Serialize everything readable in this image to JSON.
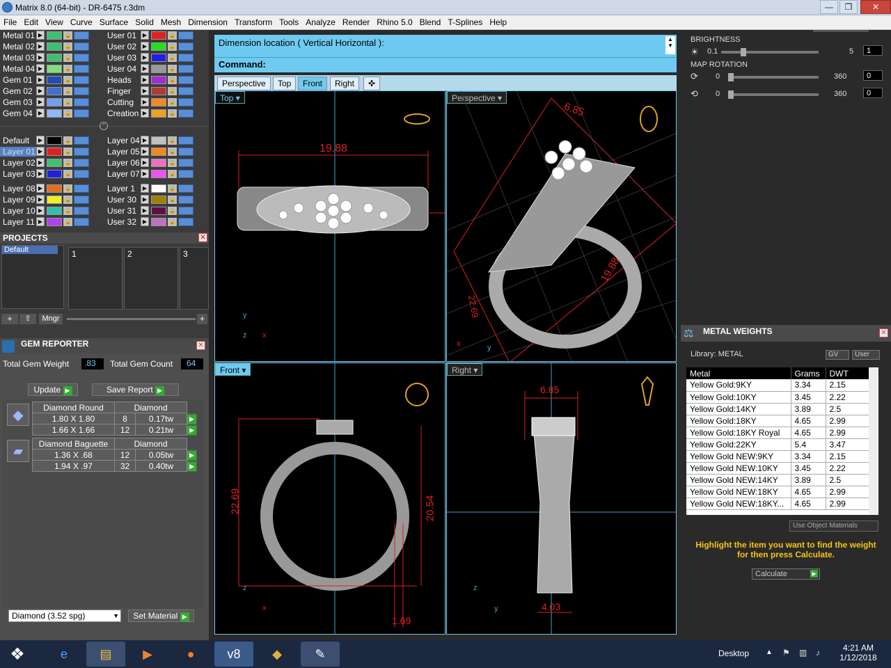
{
  "window": {
    "title": "Matrix 8.0 (64-bit) - DR-6475 r.3dm"
  },
  "menu": [
    "File",
    "Edit",
    "View",
    "Curve",
    "Surface",
    "Solid",
    "Mesh",
    "Dimension",
    "Transform",
    "Tools",
    "Analyze",
    "Render",
    "Rhino 5.0",
    "Blend",
    "T-Splines",
    "Help"
  ],
  "layers": {
    "metal_left": [
      {
        "name": "Metal 01",
        "color": "#3fbf6f"
      },
      {
        "name": "Metal 02",
        "color": "#3fbf6f"
      },
      {
        "name": "Metal 03",
        "color": "#3fbf6f"
      },
      {
        "name": "Metal 04",
        "color": "#7fdf7f"
      }
    ],
    "user_right": [
      {
        "name": "User 01",
        "color": "#e02020"
      },
      {
        "name": "User 02",
        "color": "#20e020"
      },
      {
        "name": "User 03",
        "color": "#2020e0"
      },
      {
        "name": "User 04",
        "color": "#9a9a9a"
      }
    ],
    "gem_left": [
      {
        "name": "Gem 01",
        "color": "#1f4fb0"
      },
      {
        "name": "Gem 02",
        "color": "#3f6fd0"
      },
      {
        "name": "Gem 03",
        "color": "#6f9ff0"
      },
      {
        "name": "Gem 04",
        "color": "#8fb8ff"
      }
    ],
    "misc_right": [
      {
        "name": "Heads",
        "color": "#9f2fd0"
      },
      {
        "name": "Finger",
        "color": "#b03a3a"
      },
      {
        "name": "Cutting",
        "color": "#f08a20"
      },
      {
        "name": "Creation",
        "color": "#f0a020"
      }
    ],
    "default_left": [
      {
        "name": "Default",
        "color": "#000000"
      },
      {
        "name": "Layer 01",
        "color": "#e02020"
      },
      {
        "name": "Layer 02",
        "color": "#3fbf6f"
      },
      {
        "name": "Layer 03",
        "color": "#2020e0"
      }
    ],
    "layer_right": [
      {
        "name": "Layer 04",
        "color": "#c0c0c0"
      },
      {
        "name": "Layer 05",
        "color": "#f08a20"
      },
      {
        "name": "Layer 06",
        "color": "#f070c0"
      },
      {
        "name": "Layer 07",
        "color": "#f050f0"
      }
    ],
    "bottom_left": [
      {
        "name": "Layer 08",
        "color": "#e07020"
      },
      {
        "name": "Layer 09",
        "color": "#f0f020"
      },
      {
        "name": "Layer 10",
        "color": "#30c0b0"
      },
      {
        "name": "Layer 11",
        "color": "#b040f0"
      }
    ],
    "bottom_right": [
      {
        "name": "Layer 1",
        "color": "#ffffff"
      },
      {
        "name": "User 30",
        "color": "#a08000"
      },
      {
        "name": "User 31",
        "color": "#601040"
      },
      {
        "name": "User 32",
        "color": "#c070c0"
      }
    ]
  },
  "projects": {
    "title": "PROJECTS",
    "list_item": "Default",
    "slots": [
      "1",
      "2",
      "3"
    ],
    "mngr_label": "Mngr"
  },
  "gem_reporter": {
    "title": "GEM REPORTER",
    "total_weight_label": "Total Gem Weight",
    "total_weight_value": ".83",
    "total_count_label": "Total Gem Count",
    "total_count_value": "64",
    "update_label": "Update",
    "save_label": "Save Report",
    "groups": [
      {
        "name": "Diamond Round",
        "material": "Diamond",
        "rows": [
          {
            "size": "1.80 X 1.80",
            "count": "8",
            "tw": "0.17tw"
          },
          {
            "size": "1.66 X 1.66",
            "count": "12",
            "tw": "0.21tw"
          }
        ]
      },
      {
        "name": "Diamond Baguette",
        "material": "Diamond",
        "rows": [
          {
            "size": "1.36 X .68",
            "count": "12",
            "tw": "0.05tw"
          },
          {
            "size": "1.94 X .97",
            "count": "32",
            "tw": "0.40tw"
          }
        ]
      }
    ],
    "material_select": "Diamond    (3.52 spg)",
    "set_material_label": "Set Material"
  },
  "command": {
    "prompt": "Dimension location ( Vertical  Horizontal ):",
    "label": "Command:"
  },
  "view_tabs": [
    "Perspective",
    "Top",
    "Front",
    "Right"
  ],
  "viewports": {
    "top": {
      "label": "Top",
      "dim": "19.88"
    },
    "perspective": {
      "label": "Perspective",
      "dim1": "6.85",
      "dim2": "19.88",
      "dim3": "22.69"
    },
    "front": {
      "label": "Front",
      "dim_h": "22.69",
      "dim_h2": "20.54",
      "dim_w": "1.69"
    },
    "right": {
      "label": "Right",
      "dim_top": "6.85",
      "dim_bottom": "4.03"
    }
  },
  "render_settings": {
    "brightness_label": "BRIGHTNESS",
    "brightness_min": "0.1",
    "brightness_max": "5",
    "brightness_value": "1",
    "map_rotation_label": "MAP ROTATION",
    "rot1_min": "0",
    "rot1_max": "360",
    "rot1_value": "0",
    "rot2_min": "0",
    "rot2_max": "360",
    "rot2_value": "0"
  },
  "metal_weights": {
    "title": "METAL WEIGHTS",
    "library": "Library: METAL",
    "gv_label": "GV",
    "user_label": "User",
    "headers": [
      "Metal",
      "Grams",
      "DWT"
    ],
    "rows": [
      [
        "Yellow Gold:9KY",
        "3.34",
        "2.15"
      ],
      [
        "Yellow Gold:10KY",
        "3.45",
        "2.22"
      ],
      [
        "Yellow Gold:14KY",
        "3.89",
        "2.5"
      ],
      [
        "Yellow Gold:18KY",
        "4.65",
        "2.99"
      ],
      [
        "Yellow Gold:18KY Royal",
        "4.65",
        "2.99"
      ],
      [
        "Yellow Gold:22KY",
        "5.4",
        "3.47"
      ],
      [
        "Yellow Gold NEW:9KY",
        "3.34",
        "2.15"
      ],
      [
        "Yellow Gold NEW:10KY",
        "3.45",
        "2.22"
      ],
      [
        "Yellow Gold NEW:14KY",
        "3.89",
        "2.5"
      ],
      [
        "Yellow Gold NEW:18KY",
        "4.65",
        "2.99"
      ],
      [
        "Yellow Gold NEW:18KY...",
        "4.65",
        "2.99"
      ]
    ],
    "use_object_materials": "Use Object Materials",
    "hint": "Highlight the item you want to find the weight for then press Calculate.",
    "calculate_label": "Calculate"
  },
  "taskbar": {
    "desktop_label": "Desktop",
    "time": "4:21 AM",
    "date": "1/12/2018"
  },
  "colors": {
    "accent": "#6ecaf0",
    "dim_red": "#e02020",
    "hint_yellow": "#f5c518"
  }
}
